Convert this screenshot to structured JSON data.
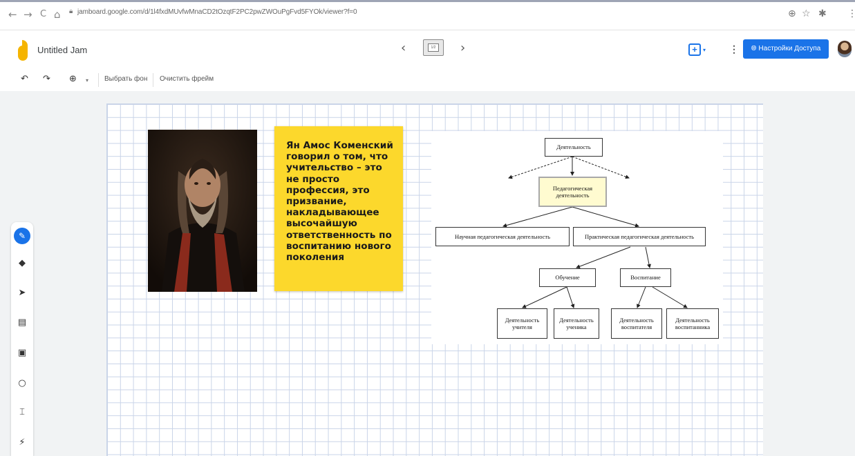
{
  "browser": {
    "url": "jamboard.google.com/d/1l4fxdMUvfwMnaCD2tOzqtF2PC2pwZWOuPgFvd5FYOk/viewer?f=0",
    "back": "←",
    "forward": "→",
    "reload": "C",
    "home": "⌂",
    "right_icons": [
      "⊕",
      "☆",
      "✱",
      "⋮"
    ]
  },
  "app": {
    "title": "Untitled Jam",
    "prev_frame": "‹",
    "next_frame": "›",
    "frame_counter": "1/2",
    "add_icon": "+",
    "share_label": "Настройки Доступа",
    "brand_color": "#1a73e8"
  },
  "toolbar": {
    "undo": "↶",
    "redo": "↷",
    "zoom": "⊕",
    "zoom_caret": "▾",
    "set_background": "Выбрать фон",
    "clear_frame": "Очистить фрейм"
  },
  "tools": [
    "pen-icon",
    "eraser-icon",
    "select-icon",
    "sticky-note-icon",
    "image-icon",
    "circle-icon",
    "text-box-icon",
    "laser-icon"
  ],
  "sticky_note": {
    "color": "#fcd82c",
    "text": "Ян Амос Коменский говорил о том, что учительство – это не просто профессия, это призвание, накладывающее высочайшую ответственность по воспитанию нового поколения"
  },
  "diagram": {
    "root": "Деятельность",
    "ped": "Педагогическая деятельность",
    "scientific": "Научная педагогическая деятельность",
    "practical": "Практическая педагогическая деятельность",
    "teaching": "Обучение",
    "upbringing": "Воспитание",
    "teacher_activity": "Деятельность учителя",
    "student_activity": "Деятельность ученика",
    "educator_activity": "Деятельность воспитателя",
    "pupil_activity": "Деятельность воспитанника"
  }
}
